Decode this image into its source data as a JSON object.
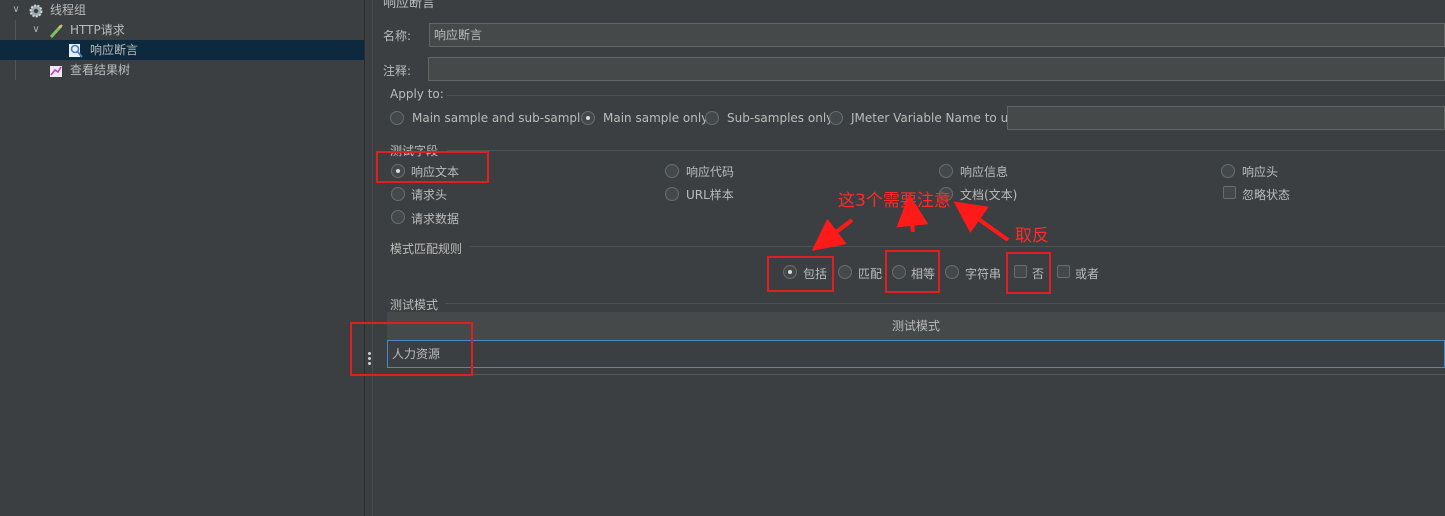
{
  "tree": {
    "items": [
      {
        "label": "线程组",
        "icon": "gear-icon"
      },
      {
        "label": "HTTP请求",
        "icon": "pen-icon"
      },
      {
        "label": "响应断言",
        "icon": "magnifier-icon"
      },
      {
        "label": "查看结果树",
        "icon": "chart-icon"
      }
    ]
  },
  "panel": {
    "title": "响应断言",
    "name_label": "名称:",
    "name_value": "响应断言",
    "comment_label": "注释:",
    "comment_value": "",
    "apply_to": {
      "title": "Apply to:",
      "options": [
        "Main sample and sub-samples",
        "Main sample only",
        "Sub-samples only",
        "JMeter Variable Name to use"
      ],
      "selected": "Main sample only",
      "variable_value": ""
    },
    "test_field": {
      "title": "测试字段",
      "options": [
        "响应文本",
        "响应代码",
        "响应信息",
        "响应头",
        "请求头",
        "URL样本",
        "文档(文本)",
        "忽略状态",
        "请求数据"
      ],
      "selected": "响应文本"
    },
    "pattern_rules": {
      "title": "模式匹配规则",
      "options": [
        "包括",
        "匹配",
        "相等",
        "字符串",
        "否",
        "或者"
      ],
      "selected": "包括"
    },
    "test_patterns": {
      "title": "测试模式",
      "column_header": "测试模式",
      "rows": [
        "人力资源"
      ]
    }
  },
  "annotations": {
    "note_three": "这3个需要注意",
    "note_invert": "取反"
  },
  "colors": {
    "background": "#3c3f41",
    "selection": "#0d293e",
    "annotation_red": "#ff2a2a"
  }
}
